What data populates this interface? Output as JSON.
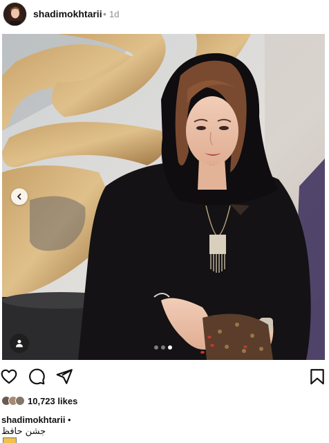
{
  "header": {
    "username": "shadimokhtarii",
    "separator": "•",
    "time": "1d"
  },
  "post": {
    "carousel_total": 3,
    "carousel_active": 3,
    "icons": {
      "prev": "chevron-left-icon",
      "tagged": "person-icon"
    }
  },
  "actions": {
    "like": "heart-icon",
    "comment": "comment-icon",
    "share": "send-icon",
    "save": "bookmark-icon"
  },
  "likes": {
    "count": "10,723",
    "label": "likes"
  },
  "caption": {
    "username": "shadimokhtarii",
    "separator": "•",
    "text": "جشن حافظ"
  }
}
